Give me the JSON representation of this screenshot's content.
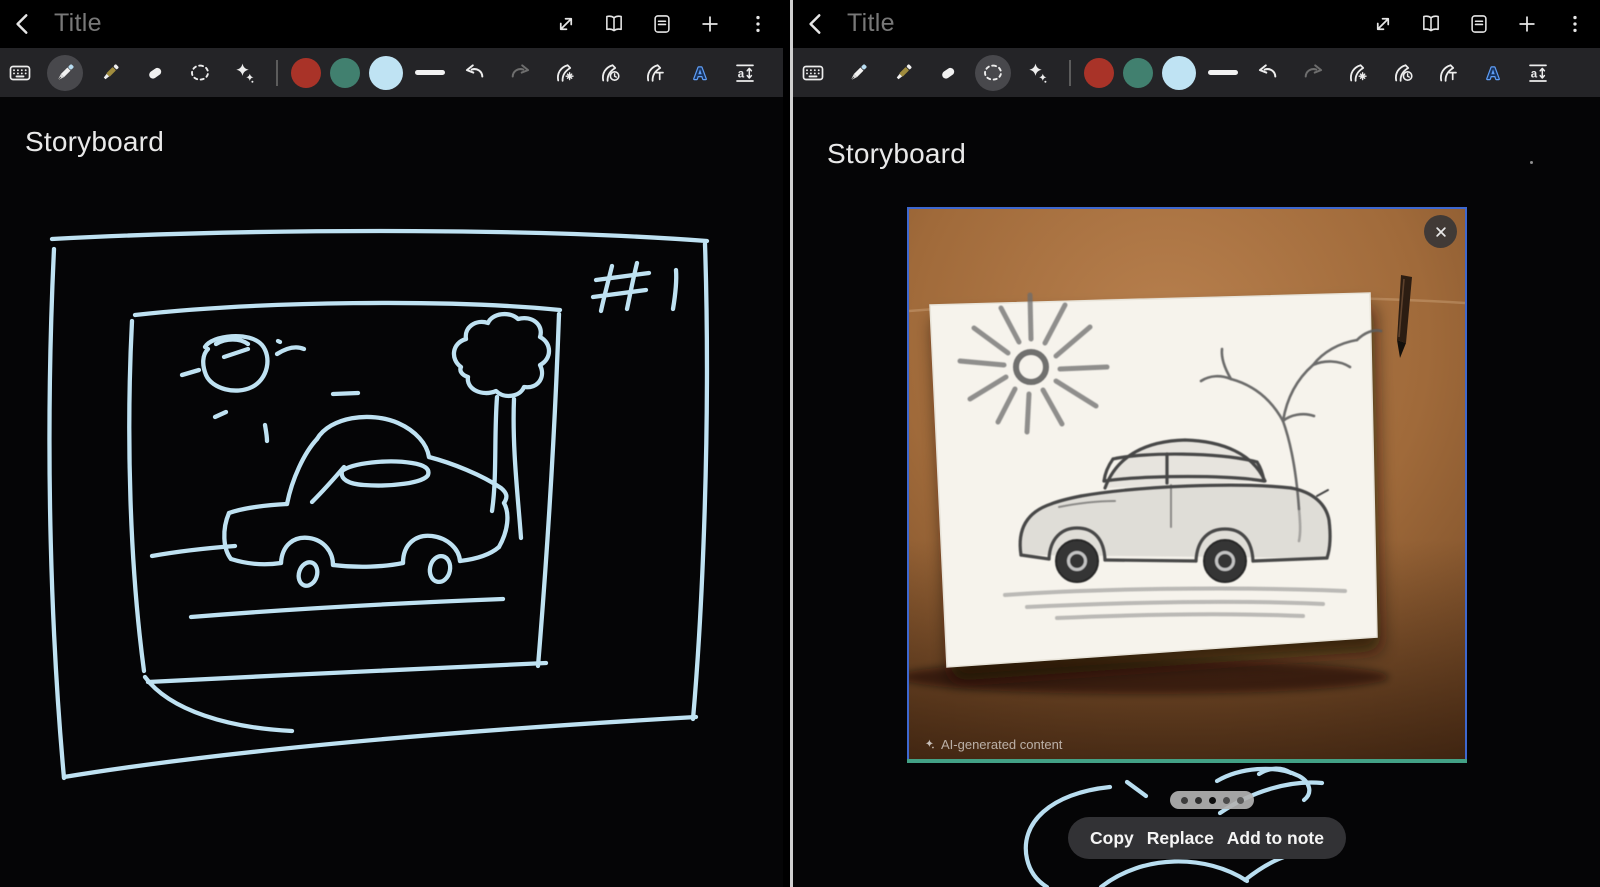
{
  "window": {
    "left_panel": {
      "title": "Title",
      "page_title": "Storyboard",
      "selected_tool": "pen"
    },
    "right_panel": {
      "title": "Title",
      "page_title": "Storyboard",
      "selected_tool": "lasso",
      "ai_overlay": {
        "watermark": "AI-generated content",
        "actions": {
          "copy": "Copy",
          "replace": "Replace",
          "add_to_note": "Add to note"
        },
        "pagination": {
          "count": 5,
          "active_index": 2,
          "pill_color": "rgba(178,178,178,0.92)",
          "dot_colors": [
            "#3c3c3c",
            "#2e2e2e",
            "#0c0c0c",
            "#4b4b4b",
            "#595959"
          ]
        }
      }
    }
  },
  "toolbar": {
    "palette": {
      "red": "#a93328",
      "teal": "#41806f",
      "light_blue": "#bfe3f3"
    },
    "selected_color": "light_blue"
  },
  "colors": {
    "ink": "#bfe2f2",
    "selection_border": "#3e68cf",
    "selection_bottom_line": "#43a185",
    "accent_blue": "#5f9ef6",
    "toolbar_bg": "#242427"
  }
}
